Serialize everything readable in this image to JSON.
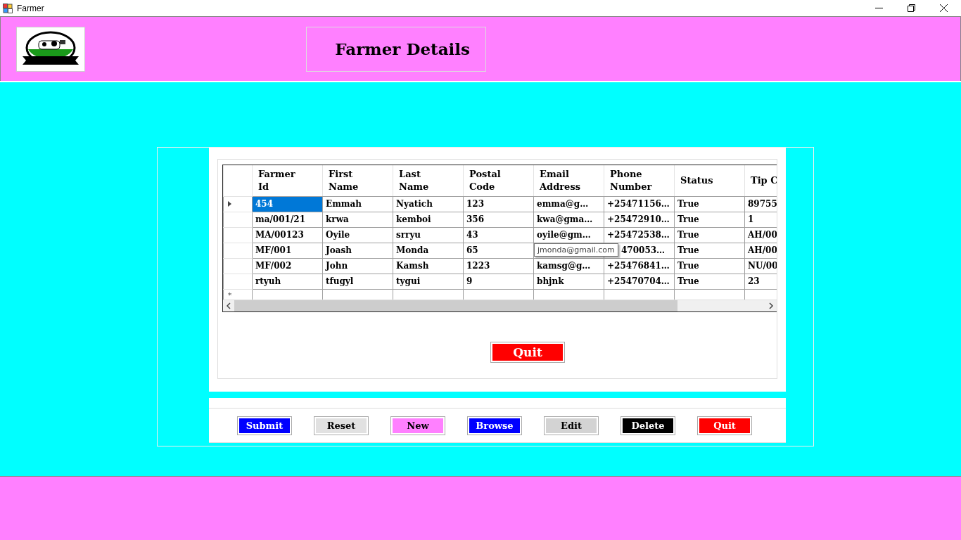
{
  "window": {
    "title": "Farmer"
  },
  "header": {
    "title": "Farmer Details"
  },
  "grid": {
    "columns": [
      "Farmer Id",
      "First Name",
      "Last Name",
      "Postal Code",
      "Email Address",
      "Phone Number",
      "Status",
      "Tip C"
    ],
    "rows": [
      {
        "selected": true,
        "cells": [
          "454",
          "Emmah",
          "Nyatich",
          "123",
          "emma@g…",
          "+25471156…",
          "True",
          "89755"
        ]
      },
      {
        "selected": false,
        "cells": [
          "ma/001/21",
          "krwa",
          "kemboi",
          "356",
          "kwa@gma…",
          "+25472910…",
          "True",
          "1"
        ]
      },
      {
        "selected": false,
        "cells": [
          "MA/00123",
          "Oyile",
          "srryu",
          "43",
          "oyile@gm…",
          "+25472538…",
          "True",
          "AH/00"
        ]
      },
      {
        "selected": false,
        "cells": [
          "MF/001",
          "Joash",
          "Monda",
          "65",
          null,
          "470053…",
          "True",
          "AH/00"
        ]
      },
      {
        "selected": false,
        "cells": [
          "MF/002",
          "John",
          "Kamsh",
          "1223",
          "kamsg@g…",
          "+25476841…",
          "True",
          "NU/00"
        ]
      },
      {
        "selected": false,
        "cells": [
          "rtyuh",
          "tfugyl",
          "tygui",
          "9",
          "bhjnk",
          "+25470704…",
          "True",
          "23"
        ]
      }
    ],
    "new_row_marker": "*",
    "tooltip": "jmonda@gmail.com"
  },
  "panel_button": {
    "label": "Quit",
    "color": "#ff0000"
  },
  "buttons": [
    {
      "label": "Submit",
      "color": "#0000ff"
    },
    {
      "label": "Reset",
      "color": "#e1e1e1"
    },
    {
      "label": "New",
      "color": "#ff80ff"
    },
    {
      "label": "Browse",
      "color": "#0000ff"
    },
    {
      "label": "Edit",
      "color": "#d3d3d3"
    },
    {
      "label": "Delete",
      "color": "#000000"
    },
    {
      "label": "Quit",
      "color": "#ff0000"
    }
  ]
}
